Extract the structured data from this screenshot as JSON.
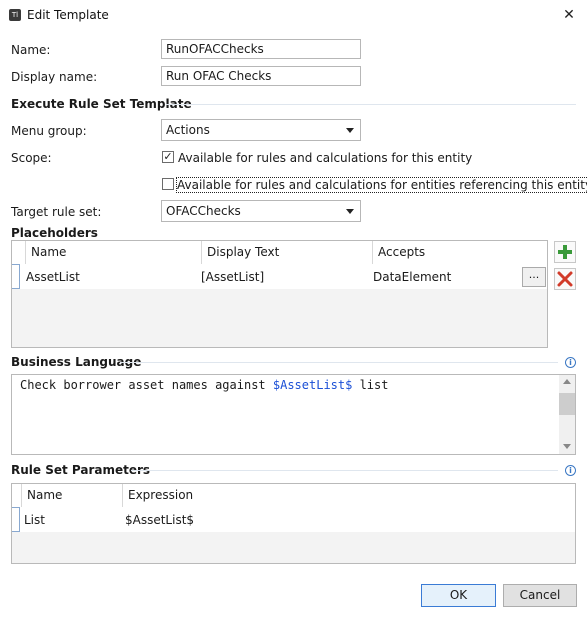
{
  "window": {
    "title": "Edit Template",
    "app_icon": "Tl"
  },
  "form": {
    "name_label": "Name:",
    "name_value": "RunOFACChecks",
    "display_name_label": "Display name:",
    "display_name_value": "Run OFAC Checks"
  },
  "execute_section": {
    "heading": "Execute Rule Set Template",
    "menu_group_label": "Menu group:",
    "menu_group_value": "Actions",
    "scope_label": "Scope:",
    "scope_option1": {
      "label": "Available for rules and calculations for this entity",
      "checked": true,
      "mark": "✓"
    },
    "scope_option2": {
      "label": "Available for rules and calculations for entities referencing this entity",
      "checked": false,
      "mark": ""
    },
    "target_label": "Target rule set:",
    "target_value": "OFACChecks"
  },
  "placeholders": {
    "heading": "Placeholders",
    "columns": [
      "Name",
      "Display Text",
      "Accepts"
    ],
    "rows": [
      {
        "name": "AssetList",
        "display_text": "[AssetList]",
        "accepts": "DataElement",
        "button": "..."
      }
    ],
    "add_icon": "plus-icon",
    "delete_icon": "delete-x-icon"
  },
  "business_language": {
    "heading": "Business Language",
    "text_prefix": "Check borrower asset names against ",
    "text_variable": "$AssetList$",
    "text_suffix": " list",
    "variable_color": "#1a4fd6"
  },
  "rule_set_parameters": {
    "heading": "Rule Set Parameters",
    "columns": [
      "Name",
      "Expression"
    ],
    "rows": [
      {
        "name": "List",
        "expression": "$AssetList$"
      }
    ]
  },
  "buttons": {
    "ok": "OK",
    "cancel": "Cancel"
  }
}
